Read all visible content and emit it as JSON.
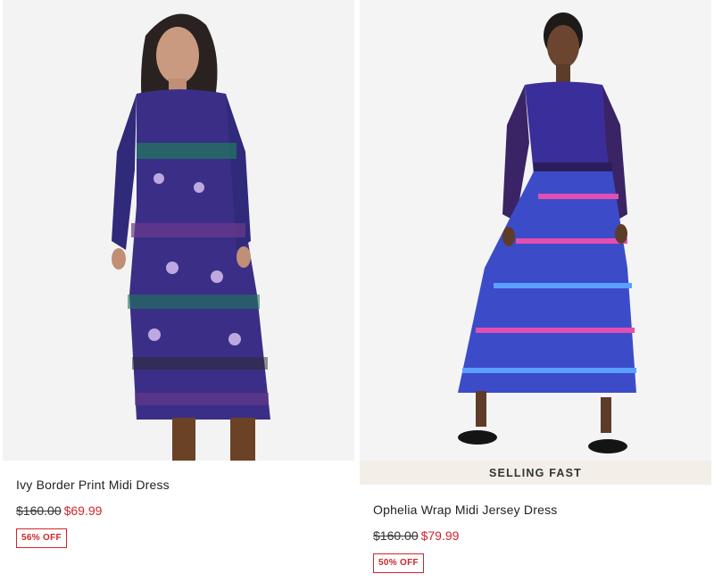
{
  "products": [
    {
      "name": "Ivy Border Print Midi Dress",
      "was_price": "$160.00",
      "sale_price": "$69.99",
      "discount": "56% OFF",
      "badge": ""
    },
    {
      "name": "Ophelia Wrap Midi Jersey Dress",
      "was_price": "$160.00",
      "sale_price": "$79.99",
      "discount": "50% OFF",
      "badge": "SELLING FAST"
    }
  ],
  "colors": {
    "sale_red": "#d0252a",
    "badge_bg": "#f3efe8",
    "photo_bg": "#f2f2f2"
  }
}
